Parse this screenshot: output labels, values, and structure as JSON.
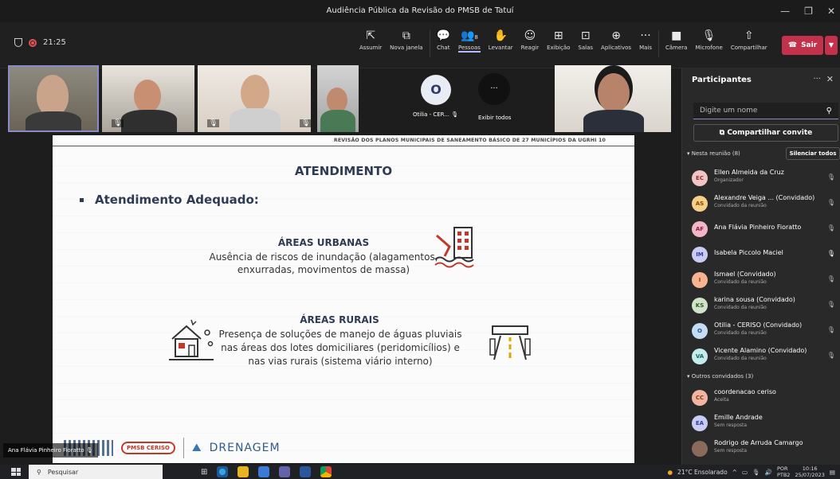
{
  "window": {
    "title": "Audiência Pública da Revisão do PMSB de Tatuí",
    "controls": [
      "—",
      "❐",
      "✕"
    ]
  },
  "toolbar": {
    "timer": "21:25",
    "tools": [
      {
        "id": "assumir",
        "icon": "⇱",
        "label": "Assumir"
      },
      {
        "id": "nova-janela",
        "icon": "⧉",
        "label": "Nova janela"
      },
      {
        "id": "chat",
        "icon": "💬",
        "label": "Chat"
      },
      {
        "id": "pessoas",
        "icon": "👥",
        "label": "Pessoas",
        "badge": "8"
      },
      {
        "id": "levantar",
        "icon": "✋",
        "label": "Levantar"
      },
      {
        "id": "reagir",
        "icon": "☺",
        "label": "Reagir"
      },
      {
        "id": "exibicao",
        "icon": "⊞",
        "label": "Exibição"
      },
      {
        "id": "salas",
        "icon": "⊡",
        "label": "Salas"
      },
      {
        "id": "aplicativos",
        "icon": "⊕",
        "label": "Aplicativos"
      },
      {
        "id": "mais",
        "icon": "···",
        "label": "Mais"
      },
      {
        "id": "camera",
        "icon": "■",
        "label": "Câmera"
      },
      {
        "id": "microfone",
        "icon": "🎙",
        "label": "Microfone"
      },
      {
        "id": "compartilhar",
        "icon": "⇧",
        "label": "Compartilhar"
      }
    ],
    "leave_label": "Sair"
  },
  "gallery": {
    "otilia_initial": "O",
    "otilia_label": "Otilia - CER...",
    "show_all": "Exibir todos",
    "more": "···"
  },
  "slide": {
    "header": "REVISÃO DOS PLANOS MUNICIPAIS DE SANEAMENTO BÁSICO DE 27 MUNICÍPIOS DA UGRHI 10",
    "title": "ATENDIMENTO",
    "bullet": "Atendimento Adequado:",
    "urban_title": "ÁREAS URBANAS",
    "urban_text": "Ausência de riscos de inundação (alagamentos, enxurradas, movimentos de massa)",
    "rural_title": "ÁREAS RURAIS",
    "rural_text": "Presença de soluções de manejo de águas pluviais nas áreas dos lotes domiciliares (peridomicílios) e nas vias rurais (sistema viário interno)",
    "logo_text": "PMSB CERISO",
    "footer": "DRENAGEM"
  },
  "presenter_label": "Ana Flávia Pinheiro Fioratto",
  "panel": {
    "title": "Participantes",
    "search_placeholder": "Digite um nome",
    "invite": "Compartilhar convite",
    "section_in": "Nesta reunião (8)",
    "mute_all": "Silenciar todos",
    "section_others": "Outros convidados (3)",
    "people": [
      {
        "initials": "EC",
        "name": "Ellen Almeida da Cruz",
        "role": "Organizador",
        "color": "#f2c5c5",
        "fg": "#8a3030"
      },
      {
        "initials": "AS",
        "name": "Alexandre Veiga ... (Convidado)",
        "role": "Convidado da reunião",
        "color": "#f7cf88",
        "fg": "#7a4d00"
      },
      {
        "initials": "AF",
        "name": "Ana Flávia Pinheiro Fioratto",
        "role": "",
        "color": "#f2b6c7",
        "fg": "#8a1f46"
      },
      {
        "initials": "IM",
        "name": "Isabela Piccolo Maciel",
        "role": "",
        "color": "#c9cdf5",
        "fg": "#2f3aa0"
      },
      {
        "initials": "I",
        "name": "Ismael (Convidado)",
        "role": "Convidado da reunião",
        "color": "#f8b392",
        "fg": "#8a3a10"
      },
      {
        "initials": "KS",
        "name": "karina sousa (Convidado)",
        "role": "Convidado da reunião",
        "color": "#cfe3c8",
        "fg": "#2f5a22"
      },
      {
        "initials": "O",
        "name": "Otilia - CERISO (Convidado)",
        "role": "Convidado da reunião",
        "color": "#c5dcf5",
        "fg": "#20508a"
      },
      {
        "initials": "VA",
        "name": "Vicente Alamino (Convidado)",
        "role": "Convidado da reunião",
        "color": "#c5ecec",
        "fg": "#1d6464"
      }
    ],
    "others": [
      {
        "initials": "CC",
        "name": "coordenacao ceriso",
        "role": "Aceita",
        "color": "#f2b6a0",
        "fg": "#8a3a20"
      },
      {
        "initials": "EA",
        "name": "Emille Andrade",
        "role": "Sem resposta",
        "color": "#c9cdf5",
        "fg": "#2f3aa0"
      },
      {
        "initials": "",
        "name": "Rodrigo de Arruda Camargo",
        "role": "Sem resposta",
        "color": "#8a6a5a",
        "fg": "#fff"
      }
    ]
  },
  "taskbar": {
    "search": "Pesquisar",
    "weather": "21°C Ensolarado",
    "lang": "POR",
    "lang2": "PTB2",
    "time": "10:16",
    "date": "25/07/2023"
  }
}
